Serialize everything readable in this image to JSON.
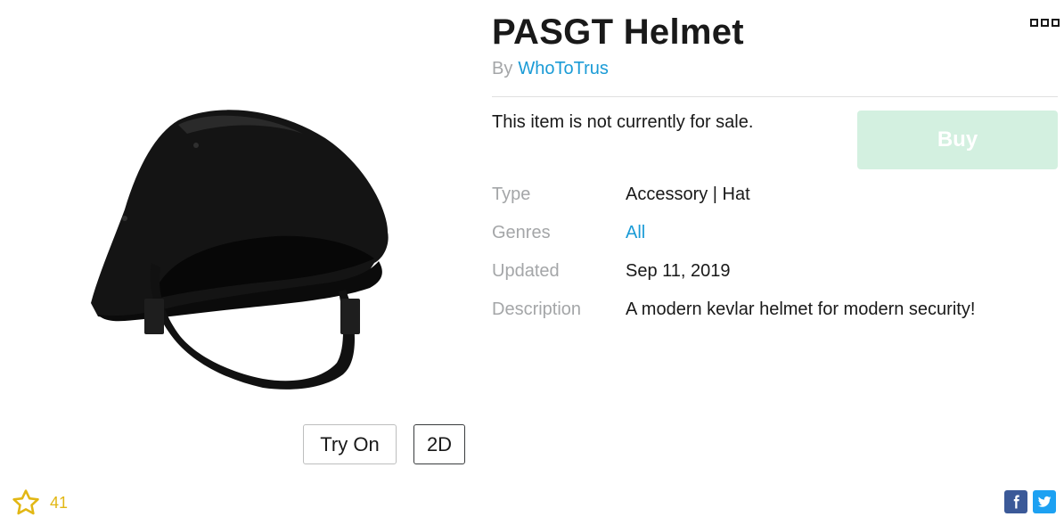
{
  "item": {
    "title": "PASGT Helmet",
    "by_label": "By",
    "creator": "WhoToTrus",
    "sale_status": "This item is not currently for sale.",
    "buy_label": "Buy"
  },
  "details": [
    {
      "label": "Type",
      "value": "Accessory | Hat"
    },
    {
      "label": "Genres",
      "value": "All"
    },
    {
      "label": "Updated",
      "value": "Sep 11, 2019"
    },
    {
      "label": "Description",
      "value": "A modern kevlar helmet for modern security!"
    }
  ],
  "preview": {
    "try_on_label": "Try On",
    "toggle_2d_label": "2D"
  },
  "favorites": {
    "count": "41",
    "icon": "star-outline-icon"
  },
  "share": {
    "facebook_icon": "facebook-icon",
    "twitter_icon": "twitter-icon"
  },
  "colors": {
    "link": "#1a9bd6",
    "buy_disabled": "#d3f0e0",
    "star": "#e2b714",
    "facebook": "#3b5998",
    "twitter": "#1da1f2"
  }
}
